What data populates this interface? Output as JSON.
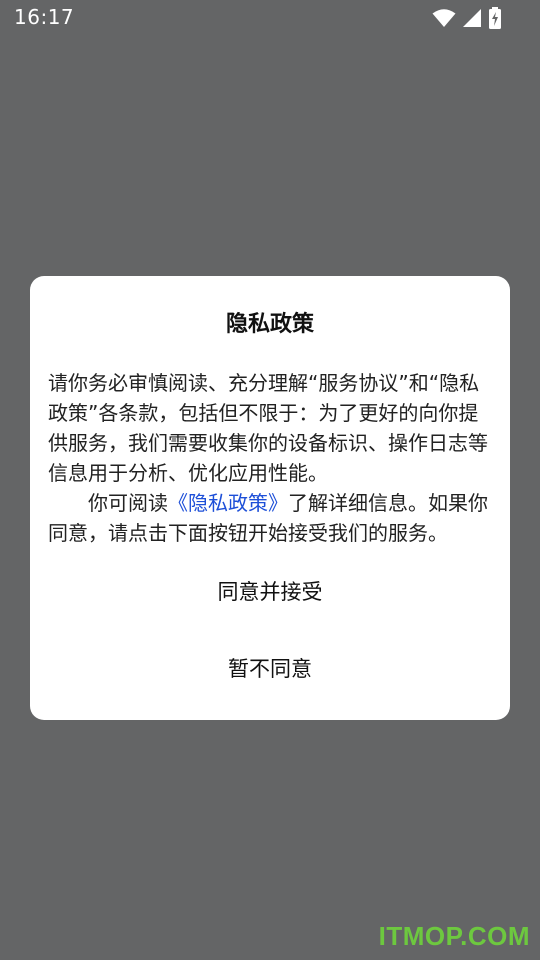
{
  "status_bar": {
    "time": "16:17",
    "icons": [
      "wifi-icon",
      "cellular-signal-icon",
      "battery-charging-icon"
    ]
  },
  "dialog": {
    "title": "隐私政策",
    "paragraph_1": "请你务必审慎阅读、充分理解“服务协议”和“隐私政策”各条款，包括但不限于：为了更好的向你提供服务，我们需要收集你的设备标识、操作日志等信息用于分析、优化应用性能。",
    "paragraph_2_before": "你可阅读",
    "paragraph_2_link": "《隐私政策》",
    "paragraph_2_after": "了解详细信息。如果你同意，请点击下面按钮开始接受我们的服务。",
    "accept_label": "同意并接受",
    "decline_label": "暂不同意"
  },
  "watermark": "ITMOP.COM",
  "colors": {
    "overlay": "#646566",
    "dialog_bg": "#ffffff",
    "link": "#1d4fd8",
    "watermark": "#6fd33b"
  }
}
